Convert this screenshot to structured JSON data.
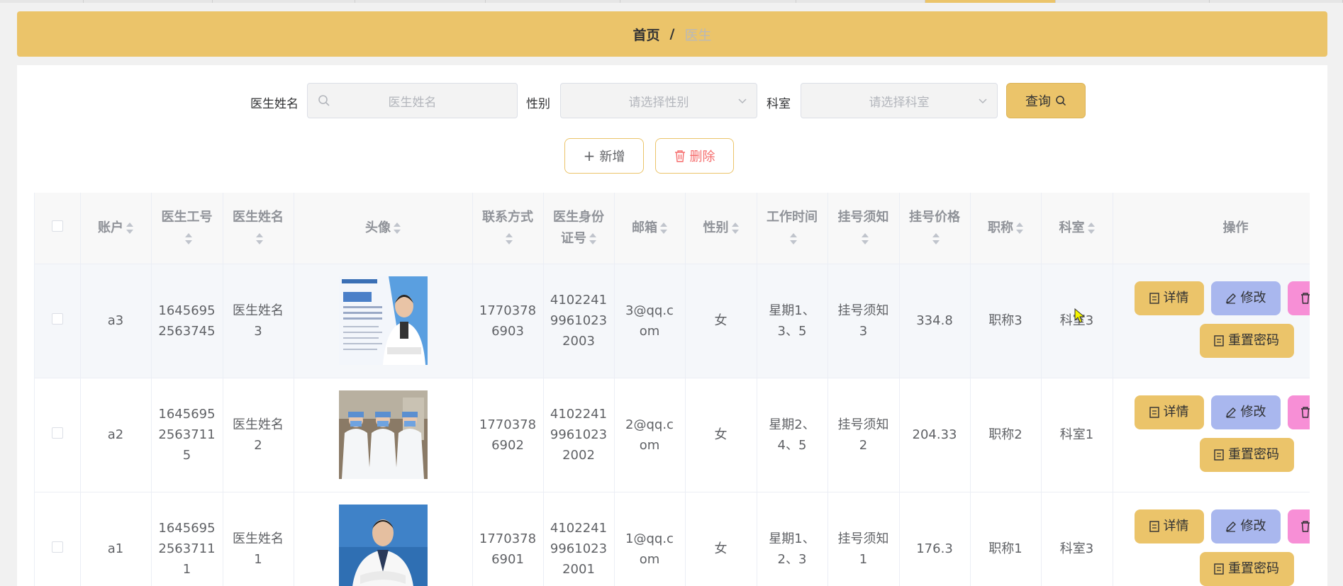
{
  "breadcrumb": {
    "home": "首页",
    "separator": "/",
    "current": "医生"
  },
  "search": {
    "name_label": "医生姓名",
    "name_placeholder": "医生姓名",
    "gender_label": "性别",
    "gender_placeholder": "请选择性别",
    "dept_label": "科室",
    "dept_placeholder": "请选择科室",
    "query_label": "查询"
  },
  "actions": {
    "add_label": "新增",
    "delete_label": "删除"
  },
  "table": {
    "headers": {
      "account": "账户",
      "doctor_no": "医生工号",
      "doctor_name": "医生姓名",
      "avatar": "头像",
      "contact": "联系方式",
      "id_card": "医生身份证号",
      "email": "邮箱",
      "gender": "性别",
      "work_time": "工作时间",
      "notice": "挂号须知",
      "price": "挂号价格",
      "title": "职称",
      "dept": "科室",
      "ops": "操作"
    },
    "rows": [
      {
        "account": "a3",
        "doctor_no": "16456952563745",
        "doctor_name": "医生姓名3",
        "contact": "17703786903",
        "id_card": "410224119961023 2003",
        "email": "3@qq.com",
        "gender": "女",
        "work_time": "星期1、3、5",
        "notice": "挂号须知3",
        "price": "334.8",
        "title": "职称3",
        "dept": "科室3",
        "avatar_icon": "doctor-poster-image"
      },
      {
        "account": "a2",
        "doctor_no": "164569525637115",
        "doctor_name": "医生姓名2",
        "contact": "17703786902",
        "id_card": "4102241996102 32002",
        "email": "2@qq.com",
        "gender": "女",
        "work_time": "星期2、4、5",
        "notice": "挂号须知2",
        "price": "204.33",
        "title": "职称2",
        "dept": "科室1",
        "avatar_icon": "medical-team-photo"
      },
      {
        "account": "a1",
        "doctor_no": "164569525637111",
        "doctor_name": "医生姓名1",
        "contact": "17703786901",
        "id_card": "41022419961023 2001",
        "email": "1@qq.com",
        "gender": "女",
        "work_time": "星期1、2、3",
        "notice": "挂号须知1",
        "price": "176.3",
        "title": "职称1",
        "dept": "科室3",
        "avatar_icon": "doctor-portrait-photo"
      }
    ],
    "row_cells": [
      {
        "doctor_no": [
          "1645695",
          "2563745"
        ],
        "doctor_name": [
          "医生姓名",
          "3"
        ],
        "contact": [
          "1770378",
          "6903"
        ],
        "id_card": [
          "4102241",
          "9961023",
          "2003"
        ],
        "email": [
          "3@qq.c",
          "om"
        ],
        "work_time": [
          "星期1、",
          "3、5"
        ],
        "notice": [
          "挂号须知",
          "3"
        ]
      },
      {
        "doctor_no": [
          "1645695",
          "2563711",
          "5"
        ],
        "doctor_name": [
          "医生姓名",
          "2"
        ],
        "contact": [
          "1770378",
          "6902"
        ],
        "id_card": [
          "4102241",
          "9961023",
          "2002"
        ],
        "email": [
          "2@qq.c",
          "om"
        ],
        "work_time": [
          "星期2、",
          "4、5"
        ],
        "notice": [
          "挂号须知",
          "2"
        ]
      },
      {
        "doctor_no": [
          "1645695",
          "2563711",
          "1"
        ],
        "doctor_name": [
          "医生姓名",
          "1"
        ],
        "contact": [
          "1770378",
          "6901"
        ],
        "id_card": [
          "4102241",
          "9961023",
          "2001"
        ],
        "email": [
          "1@qq.c",
          "om"
        ],
        "work_time": [
          "星期1、",
          "2、3"
        ],
        "notice": [
          "挂号须知",
          "1"
        ]
      }
    ],
    "header_lines": {
      "doctor_no": "医生工号",
      "doctor_name": "医生姓名",
      "contact": "联系方式",
      "id_card_1": "医生身份",
      "id_card_2": "证号",
      "work_time": "工作时间",
      "notice": "挂号须知",
      "price": "挂号价格"
    },
    "op_labels": {
      "detail": "详情",
      "edit": "修改",
      "reset": "重置密码"
    }
  },
  "colors": {
    "accent": "#ebc46a",
    "edit": "#a9b7ee",
    "delete": "#f78fd6",
    "danger_text": "#f56c6c"
  }
}
